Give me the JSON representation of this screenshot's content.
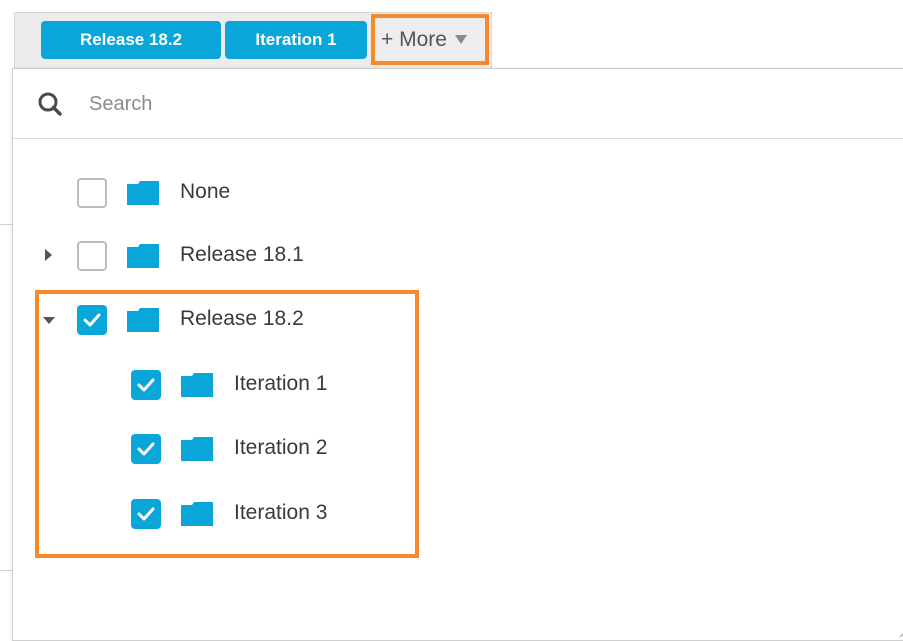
{
  "chips": [
    {
      "label": "Release 18.2"
    },
    {
      "label": "Iteration 1"
    }
  ],
  "more_button": {
    "label": "+ More"
  },
  "search": {
    "placeholder": "Search"
  },
  "tree": {
    "items": [
      {
        "label": "None",
        "checked": false,
        "expandable": false,
        "expanded": false,
        "level": 0
      },
      {
        "label": "Release 18.1",
        "checked": false,
        "expandable": true,
        "expanded": false,
        "level": 0
      },
      {
        "label": "Release 18.2",
        "checked": true,
        "expandable": true,
        "expanded": true,
        "level": 0
      },
      {
        "label": "Iteration 1",
        "checked": true,
        "expandable": false,
        "expanded": false,
        "level": 1
      },
      {
        "label": "Iteration 2",
        "checked": true,
        "expandable": false,
        "expanded": false,
        "level": 1
      },
      {
        "label": "Iteration 3",
        "checked": true,
        "expandable": false,
        "expanded": false,
        "level": 1
      }
    ]
  },
  "colors": {
    "accent": "#0aa6d9",
    "highlight": "#f68a2b",
    "folder": "#0aa6d9"
  },
  "icons": {
    "search": "magnifier-icon",
    "folder": "folder-icon",
    "check": "checkmark-icon",
    "expand": "caret-icon"
  }
}
